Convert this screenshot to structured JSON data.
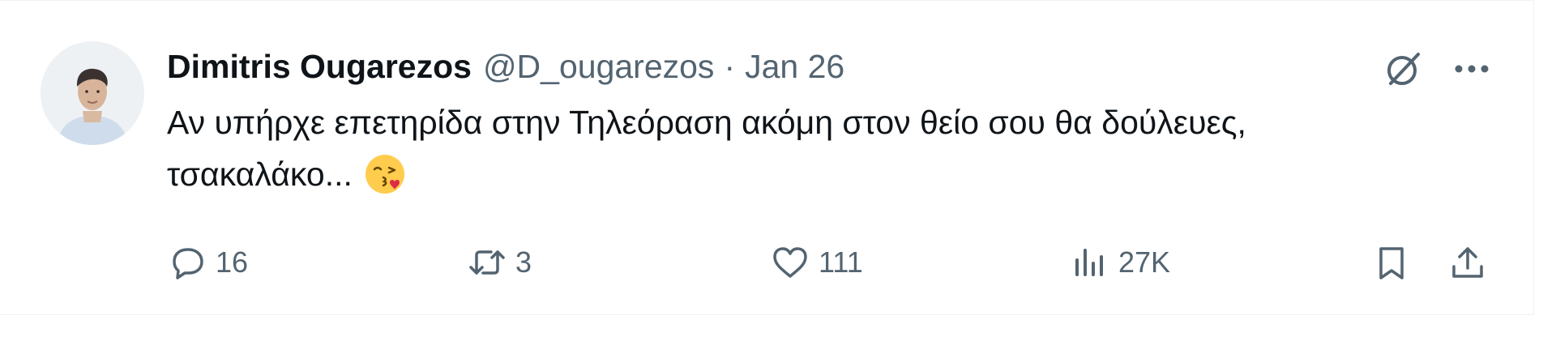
{
  "colors": {
    "text_primary": "#0f1419",
    "text_secondary": "#536471",
    "border": "#eff3f4"
  },
  "author": {
    "display_name": "Dimitris Ougarezos",
    "handle": "@D_ougarezos",
    "separator": "·",
    "date": "Jan 26"
  },
  "tweet": {
    "text_line1": "Αν υπήρχε επετηρίδα στην Τηλεόραση ακόμη στον θείο σου θα δούλευες,",
    "text_line2": "τσακαλάκο...",
    "emoji": "face-blowing-a-kiss"
  },
  "actions": {
    "reply": {
      "icon": "reply-icon",
      "count": "16"
    },
    "retweet": {
      "icon": "retweet-icon",
      "count": "3"
    },
    "like": {
      "icon": "heart-icon",
      "count": "111"
    },
    "views": {
      "icon": "views-icon",
      "count": "27K"
    },
    "bookmark": {
      "icon": "bookmark-icon"
    },
    "share": {
      "icon": "share-icon"
    }
  },
  "header_icons": [
    "grok-icon",
    "more-icon"
  ]
}
